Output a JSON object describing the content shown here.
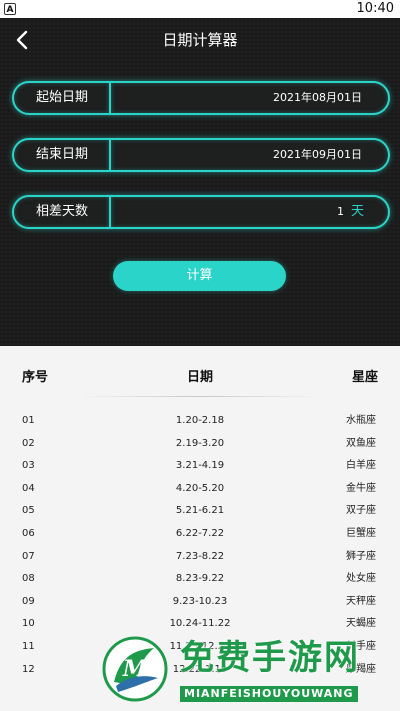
{
  "status_bar": {
    "app_icon_letter": "A",
    "time": "10:40"
  },
  "header": {
    "title": "日期计算器"
  },
  "fields": {
    "start": {
      "label": "起始日期",
      "value": "2021年08月01日"
    },
    "end": {
      "label": "结束日期",
      "value": "2021年09月01日"
    },
    "diff": {
      "label": "相差天数",
      "value": "1",
      "unit": "天"
    }
  },
  "calc_button": {
    "label": "计算"
  },
  "table": {
    "headers": {
      "index": "序号",
      "date": "日期",
      "sign": "星座"
    },
    "rows": [
      {
        "index": "01",
        "date": "1.20-2.18",
        "sign": "水瓶座"
      },
      {
        "index": "02",
        "date": "2.19-3.20",
        "sign": "双鱼座"
      },
      {
        "index": "03",
        "date": "3.21-4.19",
        "sign": "白羊座"
      },
      {
        "index": "04",
        "date": "4.20-5.20",
        "sign": "金牛座"
      },
      {
        "index": "05",
        "date": "5.21-6.21",
        "sign": "双子座"
      },
      {
        "index": "06",
        "date": "6.22-7.22",
        "sign": "巨蟹座"
      },
      {
        "index": "07",
        "date": "7.23-8.22",
        "sign": "狮子座"
      },
      {
        "index": "08",
        "date": "8.23-9.22",
        "sign": "处女座"
      },
      {
        "index": "09",
        "date": "9.23-10.23",
        "sign": "天秤座"
      },
      {
        "index": "10",
        "date": "10.24-11.22",
        "sign": "天蝎座"
      },
      {
        "index": "11",
        "date": "11.23-12.21",
        "sign": "射手座"
      },
      {
        "index": "12",
        "date": "12.22-1.19",
        "sign": "摩羯座"
      }
    ]
  },
  "watermark": {
    "text": "免费手游网",
    "subtext": "MIANFEISHOUYOUWANG",
    "logo_letter": "M"
  },
  "colors": {
    "accent": "#2bd4c8",
    "dark_bg": "#1b1b1b",
    "light_bg": "#f4f4f4",
    "watermark_green": "#1f9a4b"
  }
}
